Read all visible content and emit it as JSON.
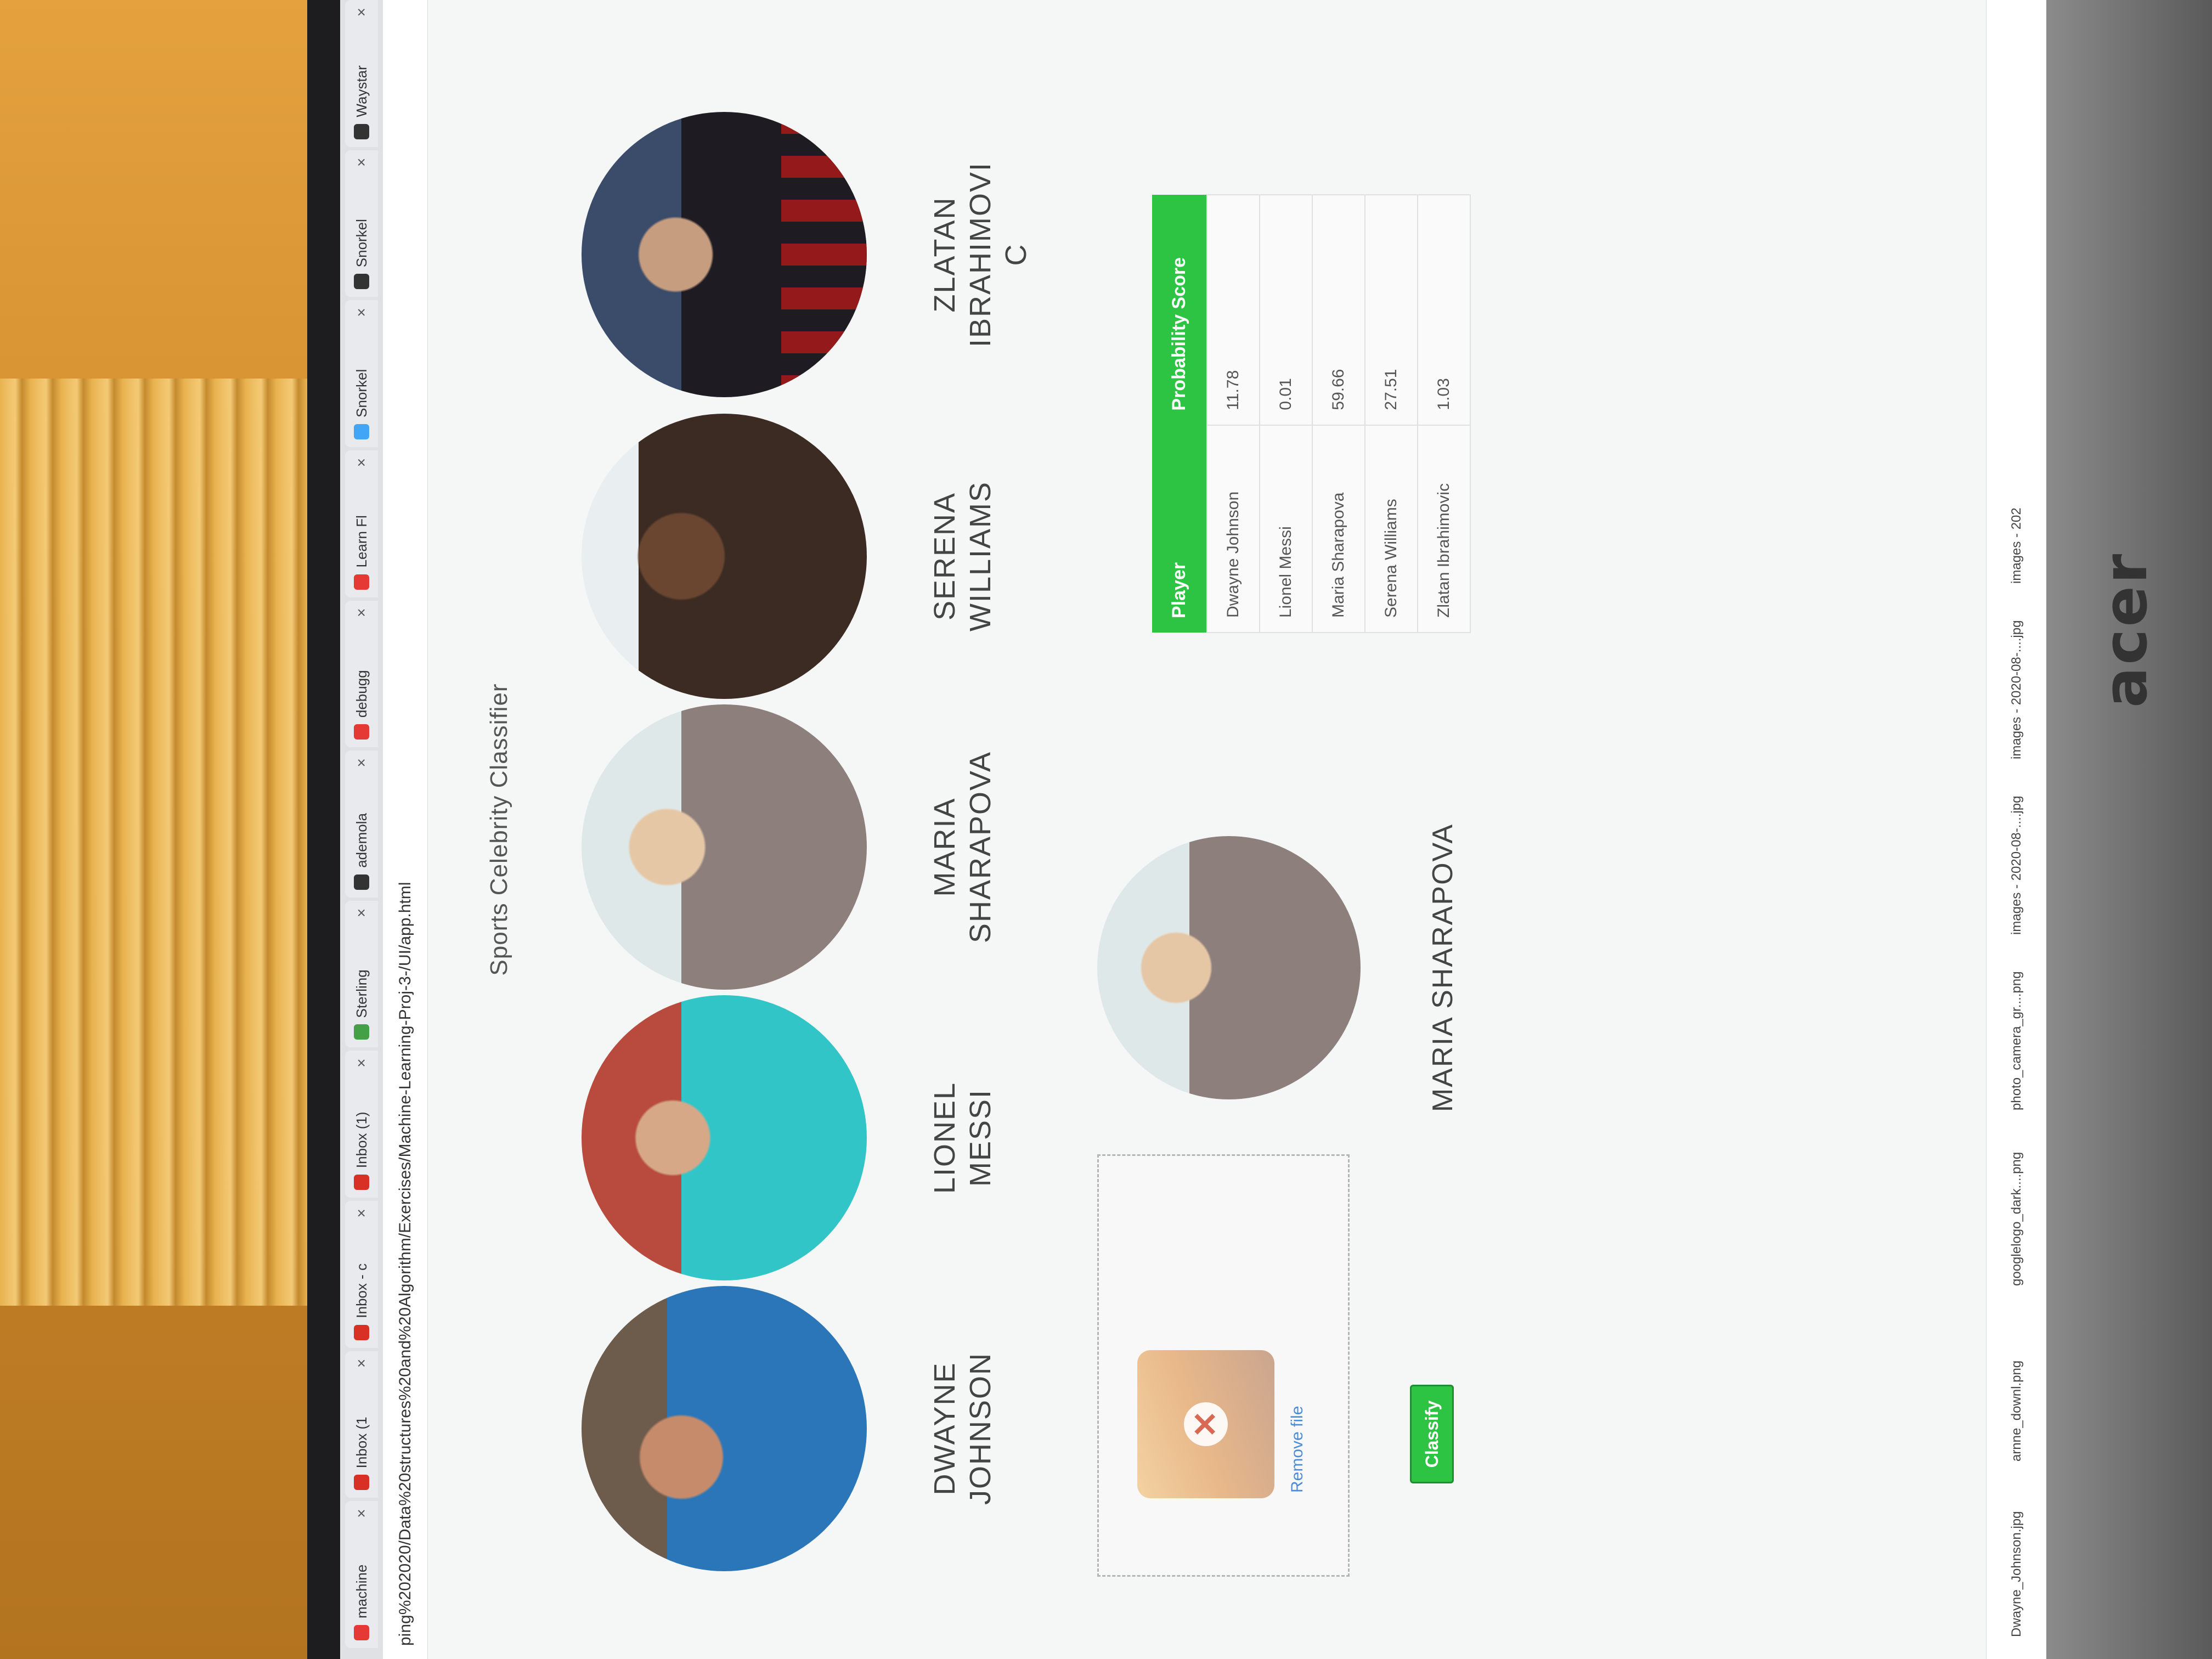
{
  "browser": {
    "tabs": [
      {
        "label": "machine",
        "icon_color": "#e53935"
      },
      {
        "label": "Inbox (1",
        "icon_color": "#d93025"
      },
      {
        "label": "Inbox - c",
        "icon_color": "#d93025"
      },
      {
        "label": "Inbox (1)",
        "icon_color": "#d93025"
      },
      {
        "label": "Sterling",
        "icon_color": "#43a047"
      },
      {
        "label": "ademola",
        "icon_color": "#333333"
      },
      {
        "label": "debugg",
        "icon_color": "#e53935"
      },
      {
        "label": "Learn Fl",
        "icon_color": "#e53935"
      },
      {
        "label": "Snorkel",
        "icon_color": "#42a5f5"
      },
      {
        "label": "Snorkel",
        "icon_color": "#333333"
      },
      {
        "label": "Waystar",
        "icon_color": "#333333"
      }
    ],
    "address": "ping%202020/Data%20structures%20and%20Algorithm/Exercises/Machine-Learning-Proj-3-/UI/app.html"
  },
  "page": {
    "title": "Sports Celebrity Classifier"
  },
  "celebrities": [
    {
      "name_line1": "DWAYNE",
      "name_line2": "JOHNSON"
    },
    {
      "name_line1": "LIONEL",
      "name_line2": "MESSI"
    },
    {
      "name_line1": "MARIA",
      "name_line2": "SHARAPOVA"
    },
    {
      "name_line1": "SERENA",
      "name_line2": "WILLIAMS"
    },
    {
      "name_line1": "ZLATAN",
      "name_line2": "IBRAHIMOVI",
      "name_line3": "C"
    }
  ],
  "upload": {
    "remove_label": "Remove file",
    "remove_icon": "close-icon",
    "classify_label": "Classify"
  },
  "result": {
    "name": "MARIA SHARAPOVA"
  },
  "table": {
    "headers": [
      "Player",
      "Probability Score"
    ],
    "rows": [
      {
        "player": "Dwayne Johnson",
        "score": "11.78"
      },
      {
        "player": "Lionel Messi",
        "score": "0.01"
      },
      {
        "player": "Maria Sharapova",
        "score": "59.66"
      },
      {
        "player": "Serena Williams",
        "score": "27.51"
      },
      {
        "player": "Zlatan Ibrahimovic",
        "score": "1.03"
      }
    ]
  },
  "downloads": [
    "Dwayne_Johnson.jpg",
    "arnne_downl.png",
    "googlelogo_dark....png",
    "photo_camera_gr....png",
    "images - 2020-08-....jpg",
    "images - 2020-08-....jpg",
    "images - 202"
  ],
  "monitor": {
    "brand": "acer"
  },
  "colors": {
    "accent": "#2ec443",
    "link": "#4c8bd8"
  }
}
